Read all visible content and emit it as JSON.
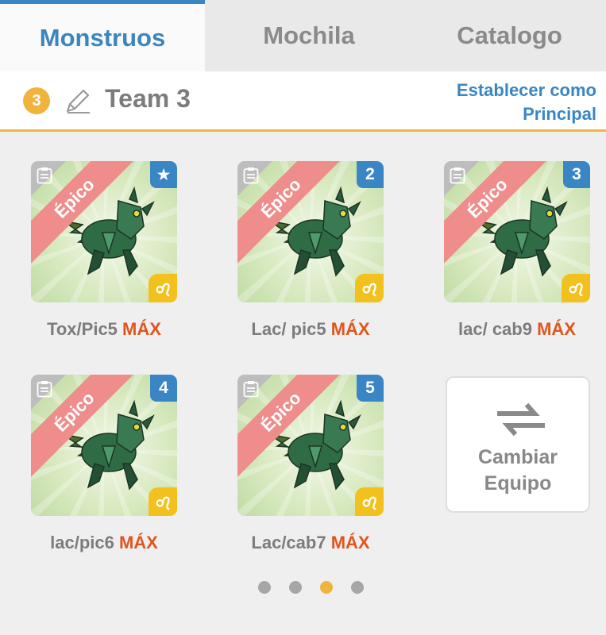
{
  "tabs": [
    {
      "label": "Monstruos",
      "active": true
    },
    {
      "label": "Mochila",
      "active": false
    },
    {
      "label": "Catalogo",
      "active": false
    }
  ],
  "team": {
    "number": "3",
    "name": "Team 3",
    "set_main_line1": "Establecer como",
    "set_main_line2": "Principal"
  },
  "monsters": [
    {
      "rarity": "Épico",
      "slot": "★",
      "name": "Tox/Pic5",
      "level": "MÁX"
    },
    {
      "rarity": "Épico",
      "slot": "2",
      "name": "Lac/ pic5",
      "level": "MÁX"
    },
    {
      "rarity": "Épico",
      "slot": "3",
      "name": "lac/ cab9",
      "level": "MÁX"
    },
    {
      "rarity": "Épico",
      "slot": "4",
      "name": "lac/pic6",
      "level": "MÁX"
    },
    {
      "rarity": "Épico",
      "slot": "5",
      "name": "Lac/cab7",
      "level": "MÁX"
    }
  ],
  "swap": {
    "line1": "Cambiar",
    "line2": "Equipo"
  },
  "pagination": {
    "total": 4,
    "current": 3
  },
  "colors": {
    "accent_blue": "#3a86c4",
    "accent_gold": "#f0b43e",
    "max_orange": "#e0551f",
    "epic_pink": "#ee8d8b"
  }
}
